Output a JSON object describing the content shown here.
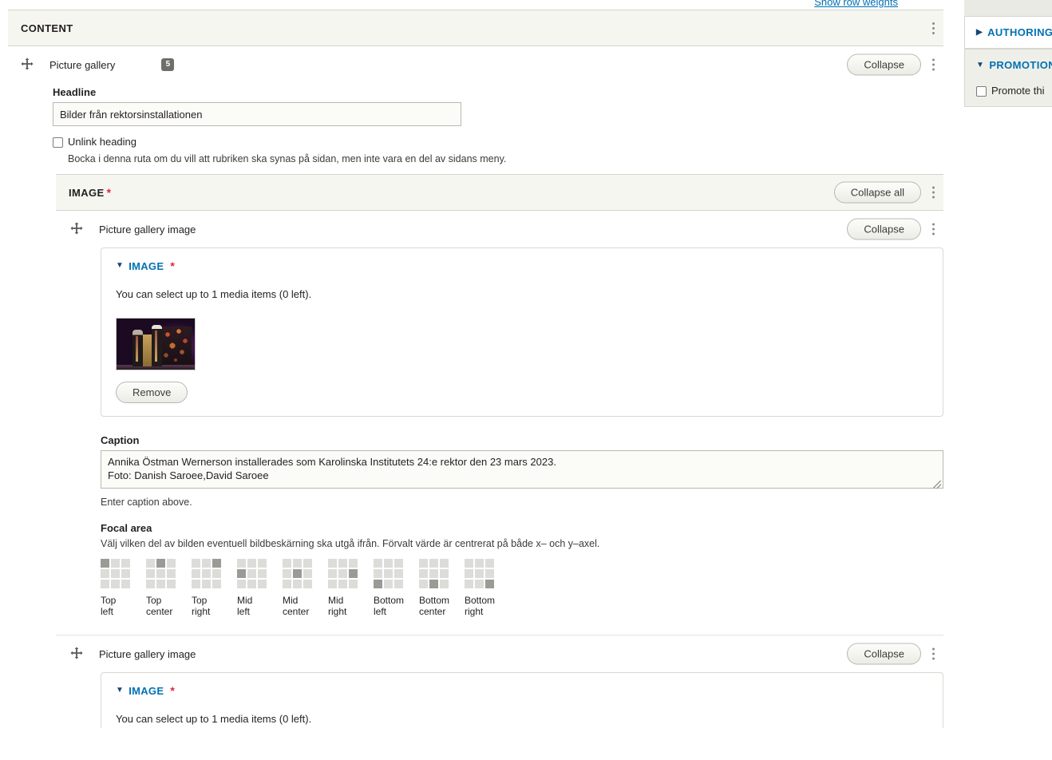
{
  "top": {
    "show_row_weights": "Show row weights"
  },
  "content_section": {
    "title": "CONTENT",
    "kebab_icon": "kebab-menu-icon"
  },
  "paragraph": {
    "drag_icon": "drag-handle-icon",
    "label": "Picture gallery",
    "count_badge": "5",
    "collapse_label": "Collapse",
    "headline": {
      "label": "Headline",
      "value": "Bilder från rektorsinstallationen",
      "placeholder": ""
    },
    "unlink": {
      "label": "Unlink heading",
      "checked": false,
      "description": "Bocka i denna ruta om du vill att rubriken ska synas på sidan, men inte vara en del av sidans meny."
    }
  },
  "image_section": {
    "title": "IMAGE",
    "required_mark": "*",
    "collapse_all_label": "Collapse all"
  },
  "items": [
    {
      "drag_icon": "drag-handle-icon",
      "label": "Picture gallery image",
      "collapse_label": "Collapse",
      "fieldset": {
        "toggle_icon": "triangle-down-icon",
        "legend": "IMAGE",
        "required_mark": "*",
        "media_note": "You can select up to 1 media items (0 left).",
        "thumbnail_alt": "installation-ceremony-thumbnail",
        "remove_label": "Remove"
      },
      "caption": {
        "label": "Caption",
        "value": "Annika Östman Wernerson installerades som Karolinska Institutets 24:e rektor den 23 mars 2023.\nFoto: Danish Saroee,David Saroee",
        "description": "Enter caption above."
      },
      "focal": {
        "label": "Focal area",
        "description": "Välj vilken del av bilden eventuell bildbeskärning ska utgå ifrån. Förvalt värde är centrerat på både x– och y–axel.",
        "options": [
          {
            "id": "top-left",
            "line1": "Top",
            "line2": "left",
            "cell": 0
          },
          {
            "id": "top-center",
            "line1": "Top",
            "line2": "center",
            "cell": 1
          },
          {
            "id": "top-right",
            "line1": "Top",
            "line2": "right",
            "cell": 2
          },
          {
            "id": "mid-left",
            "line1": "Mid",
            "line2": "left",
            "cell": 3
          },
          {
            "id": "mid-center",
            "line1": "Mid",
            "line2": "center",
            "cell": 4
          },
          {
            "id": "mid-right",
            "line1": "Mid",
            "line2": "right",
            "cell": 5
          },
          {
            "id": "bottom-left",
            "line1": "Bottom",
            "line2": "left",
            "cell": 6
          },
          {
            "id": "bottom-center",
            "line1": "Bottom",
            "line2": "center",
            "cell": 7
          },
          {
            "id": "bottom-right",
            "line1": "Bottom",
            "line2": "right",
            "cell": 8
          }
        ]
      }
    },
    {
      "drag_icon": "drag-handle-icon",
      "label": "Picture gallery image",
      "collapse_label": "Collapse",
      "fieldset": {
        "toggle_icon": "triangle-down-icon",
        "legend": "IMAGE",
        "required_mark": "*",
        "media_note": "You can select up to 1 media items (0 left)."
      }
    }
  ],
  "sidebar": {
    "authoring": {
      "toggle_icon": "triangle-right-icon",
      "title": "AUTHORING"
    },
    "promotion": {
      "toggle_icon": "triangle-down-icon",
      "title": "PROMOTION",
      "checkbox_label": "Promote thi",
      "checked": false
    }
  },
  "colors": {
    "link": "#0071b3",
    "required": "#e02443",
    "section_bg": "#f6f6f1",
    "badge_bg": "#6f6f6a"
  }
}
